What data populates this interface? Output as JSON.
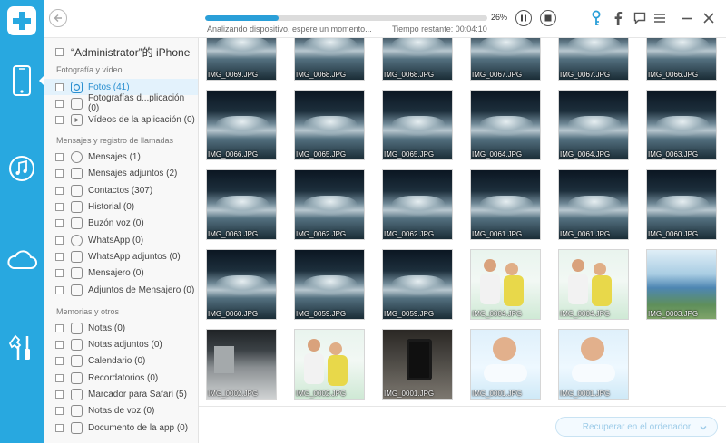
{
  "topbar": {
    "progress_percent": 26,
    "progress_label": "26%",
    "status_text": "Analizando dispositivo, espere un momento...",
    "time_text": "Tiempo restante: 00:04:10"
  },
  "sidebar": {
    "device_title": "“Administrator”的 iPhone",
    "sections": [
      {
        "label": "Fotografía y vídeo",
        "items": [
          {
            "label": "Fotos (41)",
            "icon": "photos-icon",
            "selected": true
          },
          {
            "label": "Fotografías d...plicación (0)",
            "icon": "app-photos-icon",
            "selected": false
          },
          {
            "label": "Vídeos de la aplicación (0)",
            "icon": "app-videos-icon",
            "selected": false
          }
        ]
      },
      {
        "label": "Mensajes y registro de llamadas",
        "items": [
          {
            "label": "Mensajes (1)",
            "icon": "messages-icon"
          },
          {
            "label": "Mensajes adjuntos (2)",
            "icon": "message-attachments-icon"
          },
          {
            "label": "Contactos (307)",
            "icon": "contacts-icon"
          },
          {
            "label": "Historial (0)",
            "icon": "call-history-icon"
          },
          {
            "label": "Buzón voz (0)",
            "icon": "voicemail-icon"
          },
          {
            "label": "WhatsApp (0)",
            "icon": "whatsapp-icon"
          },
          {
            "label": "WhatsApp adjuntos (0)",
            "icon": "whatsapp-attachments-icon"
          },
          {
            "label": "Mensajero (0)",
            "icon": "messenger-icon"
          },
          {
            "label": "Adjuntos de Mensajero (0)",
            "icon": "messenger-attachments-icon"
          }
        ]
      },
      {
        "label": "Memorias y otros",
        "items": [
          {
            "label": "Notas (0)",
            "icon": "notes-icon"
          },
          {
            "label": "Notas adjuntos (0)",
            "icon": "notes-attachments-icon"
          },
          {
            "label": "Calendario (0)",
            "icon": "calendar-icon"
          },
          {
            "label": "Recordatorios (0)",
            "icon": "reminders-icon"
          },
          {
            "label": "Marcador para Safari (5)",
            "icon": "safari-bookmark-icon"
          },
          {
            "label": "Notas de voz (0)",
            "icon": "voice-memos-icon"
          },
          {
            "label": "Documento de la app (0)",
            "icon": "app-document-icon"
          }
        ]
      }
    ]
  },
  "photos": [
    {
      "name": "IMG_0069.JPG",
      "style": "water"
    },
    {
      "name": "IMG_0068.JPG",
      "style": "water"
    },
    {
      "name": "IMG_0068.JPG",
      "style": "water"
    },
    {
      "name": "IMG_0067.JPG",
      "style": "water"
    },
    {
      "name": "IMG_0067.JPG",
      "style": "water"
    },
    {
      "name": "IMG_0066.JPG",
      "style": "water"
    },
    {
      "name": "IMG_0066.JPG",
      "style": "water"
    },
    {
      "name": "IMG_0065.JPG",
      "style": "water"
    },
    {
      "name": "IMG_0065.JPG",
      "style": "water"
    },
    {
      "name": "IMG_0064.JPG",
      "style": "water"
    },
    {
      "name": "IMG_0064.JPG",
      "style": "water"
    },
    {
      "name": "IMG_0063.JPG",
      "style": "water"
    },
    {
      "name": "IMG_0063.JPG",
      "style": "water"
    },
    {
      "name": "IMG_0062.JPG",
      "style": "water"
    },
    {
      "name": "IMG_0062.JPG",
      "style": "water"
    },
    {
      "name": "IMG_0061.JPG",
      "style": "water"
    },
    {
      "name": "IMG_0061.JPG",
      "style": "water"
    },
    {
      "name": "IMG_0060.JPG",
      "style": "water"
    },
    {
      "name": "IMG_0060.JPG",
      "style": "water"
    },
    {
      "name": "IMG_0059.JPG",
      "style": "water"
    },
    {
      "name": "IMG_0059.JPG",
      "style": "water"
    },
    {
      "name": "IMG_0004.JPG",
      "style": "kids"
    },
    {
      "name": "IMG_0004.JPG",
      "style": "kids"
    },
    {
      "name": "IMG_0003.JPG",
      "style": "trees"
    },
    {
      "name": "IMG_0002.JPG",
      "style": "office"
    },
    {
      "name": "IMG_0002.JPG",
      "style": "kids"
    },
    {
      "name": "IMG_0001.JPG",
      "style": "phone"
    },
    {
      "name": "IMG_0001.JPG",
      "style": "face"
    },
    {
      "name": "IMG_0001.JPG",
      "style": "face"
    }
  ],
  "bottombar": {
    "recover_label": "Recuperar en el ordenador"
  },
  "colors": {
    "brand_blue": "#28a8e0",
    "accent_blue": "#2a9fd8",
    "selected_row_bg": "#e3f2fc"
  }
}
